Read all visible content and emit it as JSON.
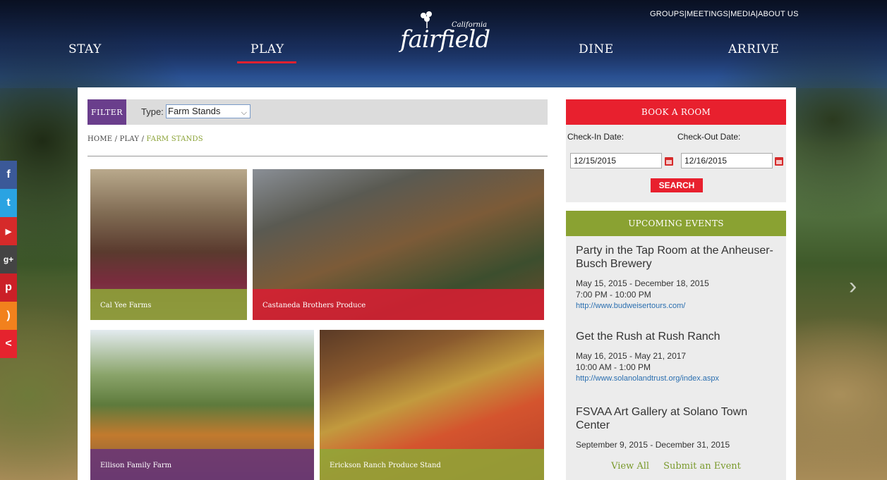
{
  "header": {
    "top_links": [
      "GROUPS",
      "MEETINGS",
      "MEDIA",
      "ABOUT US"
    ],
    "nav": {
      "stay": "STAY",
      "play": "PLAY",
      "dine": "DINE",
      "arrive": "ARRIVE"
    },
    "logo": {
      "name": "fairfield",
      "region": "California"
    }
  },
  "social": [
    {
      "name": "facebook-icon",
      "glyph": "f",
      "color": "#3b5998"
    },
    {
      "name": "twitter-icon",
      "glyph": "t",
      "color": "#2aa3e2"
    },
    {
      "name": "youtube-icon",
      "glyph": "▶",
      "color": "#d62a2a"
    },
    {
      "name": "google-plus-icon",
      "glyph": "g+",
      "color": "#444444"
    },
    {
      "name": "pinterest-icon",
      "glyph": "p",
      "color": "#cb2027"
    },
    {
      "name": "rss-icon",
      "glyph": ")",
      "color": "#f2811d"
    },
    {
      "name": "share-icon",
      "glyph": "<",
      "color": "#e5232e"
    }
  ],
  "filter": {
    "button": "FILTER",
    "type_label": "Type:",
    "type_value": "Farm Stands"
  },
  "breadcrumb": {
    "home": "HOME",
    "sep1": " / ",
    "play": "PLAY",
    "sep2": " / ",
    "current": "FARM STANDS"
  },
  "tiles": [
    {
      "label": "Cal Yee Farms"
    },
    {
      "label": "Castaneda Brothers Produce"
    },
    {
      "label": "Ellison Family Farm"
    },
    {
      "label": "Erickson Ranch Produce Stand"
    }
  ],
  "booking": {
    "title": "BOOK A ROOM",
    "checkin_label": "Check-In Date:",
    "checkout_label": "Check-Out Date:",
    "checkin_value": "12/15/2015",
    "checkout_value": "12/16/2015",
    "search": "SEARCH"
  },
  "events": {
    "title": "UPCOMING EVENTS",
    "items": [
      {
        "title": "Party in the Tap Room at the Anheuser-Busch Brewery",
        "dates": "May 15, 2015 - December 18, 2015",
        "time": "7:00 PM - 10:00 PM",
        "link": "http://www.budweisertours.com/"
      },
      {
        "title": "Get the Rush at Rush Ranch",
        "dates": "May 16, 2015 - May 21, 2017",
        "time": "10:00 AM - 1:00 PM",
        "link": "http://www.solanolandtrust.org/index.aspx"
      },
      {
        "title": "FSVAA Art Gallery at Solano Town Center",
        "dates": "September 9, 2015 - December 31, 2015"
      }
    ],
    "view_all": "View All",
    "submit": "Submit an Event"
  },
  "colors": {
    "red": "#e8202e",
    "green": "#8aa232",
    "purple": "#6a3e8c"
  }
}
